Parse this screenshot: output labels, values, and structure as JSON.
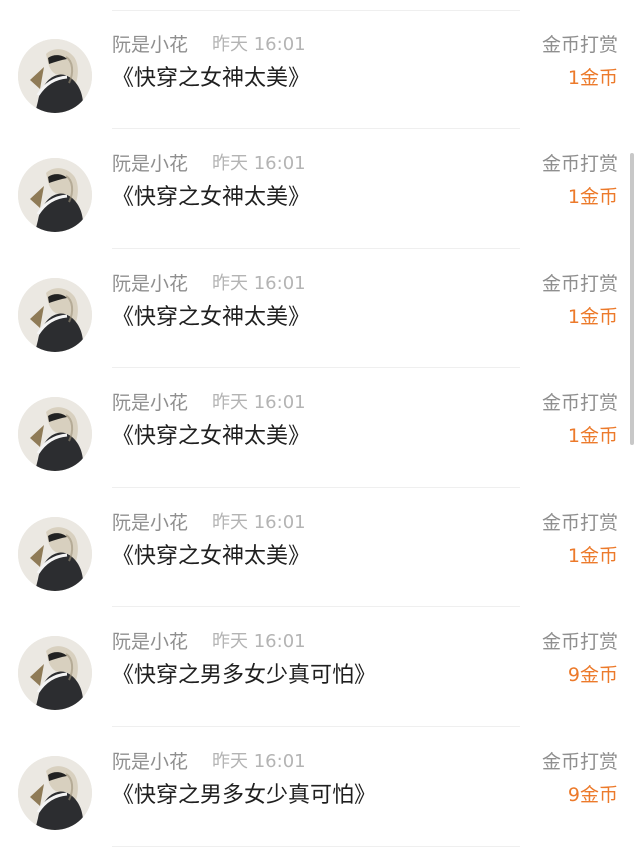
{
  "colors": {
    "accent_amount": "#ec7a2b",
    "name_text": "#8f8f8f",
    "time_text": "#b4b4b4",
    "title_text": "#1f1f1f"
  },
  "records": [
    {
      "name": "阮是小花",
      "time": "昨天 16:01",
      "title": "《快穿之女神太美》",
      "type": "金币打赏",
      "amount": "1金币",
      "avatar_icon": "user-avatar-icon"
    },
    {
      "name": "阮是小花",
      "time": "昨天 16:01",
      "title": "《快穿之女神太美》",
      "type": "金币打赏",
      "amount": "1金币",
      "avatar_icon": "user-avatar-icon"
    },
    {
      "name": "阮是小花",
      "time": "昨天 16:01",
      "title": "《快穿之女神太美》",
      "type": "金币打赏",
      "amount": "1金币",
      "avatar_icon": "user-avatar-icon"
    },
    {
      "name": "阮是小花",
      "time": "昨天 16:01",
      "title": "《快穿之女神太美》",
      "type": "金币打赏",
      "amount": "1金币",
      "avatar_icon": "user-avatar-icon"
    },
    {
      "name": "阮是小花",
      "time": "昨天 16:01",
      "title": "《快穿之女神太美》",
      "type": "金币打赏",
      "amount": "1金币",
      "avatar_icon": "user-avatar-icon"
    },
    {
      "name": "阮是小花",
      "time": "昨天 16:01",
      "title": "《快穿之男多女少真可怕》",
      "type": "金币打赏",
      "amount": "9金币",
      "avatar_icon": "user-avatar-icon"
    },
    {
      "name": "阮是小花",
      "time": "昨天 16:01",
      "title": "《快穿之男多女少真可怕》",
      "type": "金币打赏",
      "amount": "9金币",
      "avatar_icon": "user-avatar-icon"
    }
  ]
}
